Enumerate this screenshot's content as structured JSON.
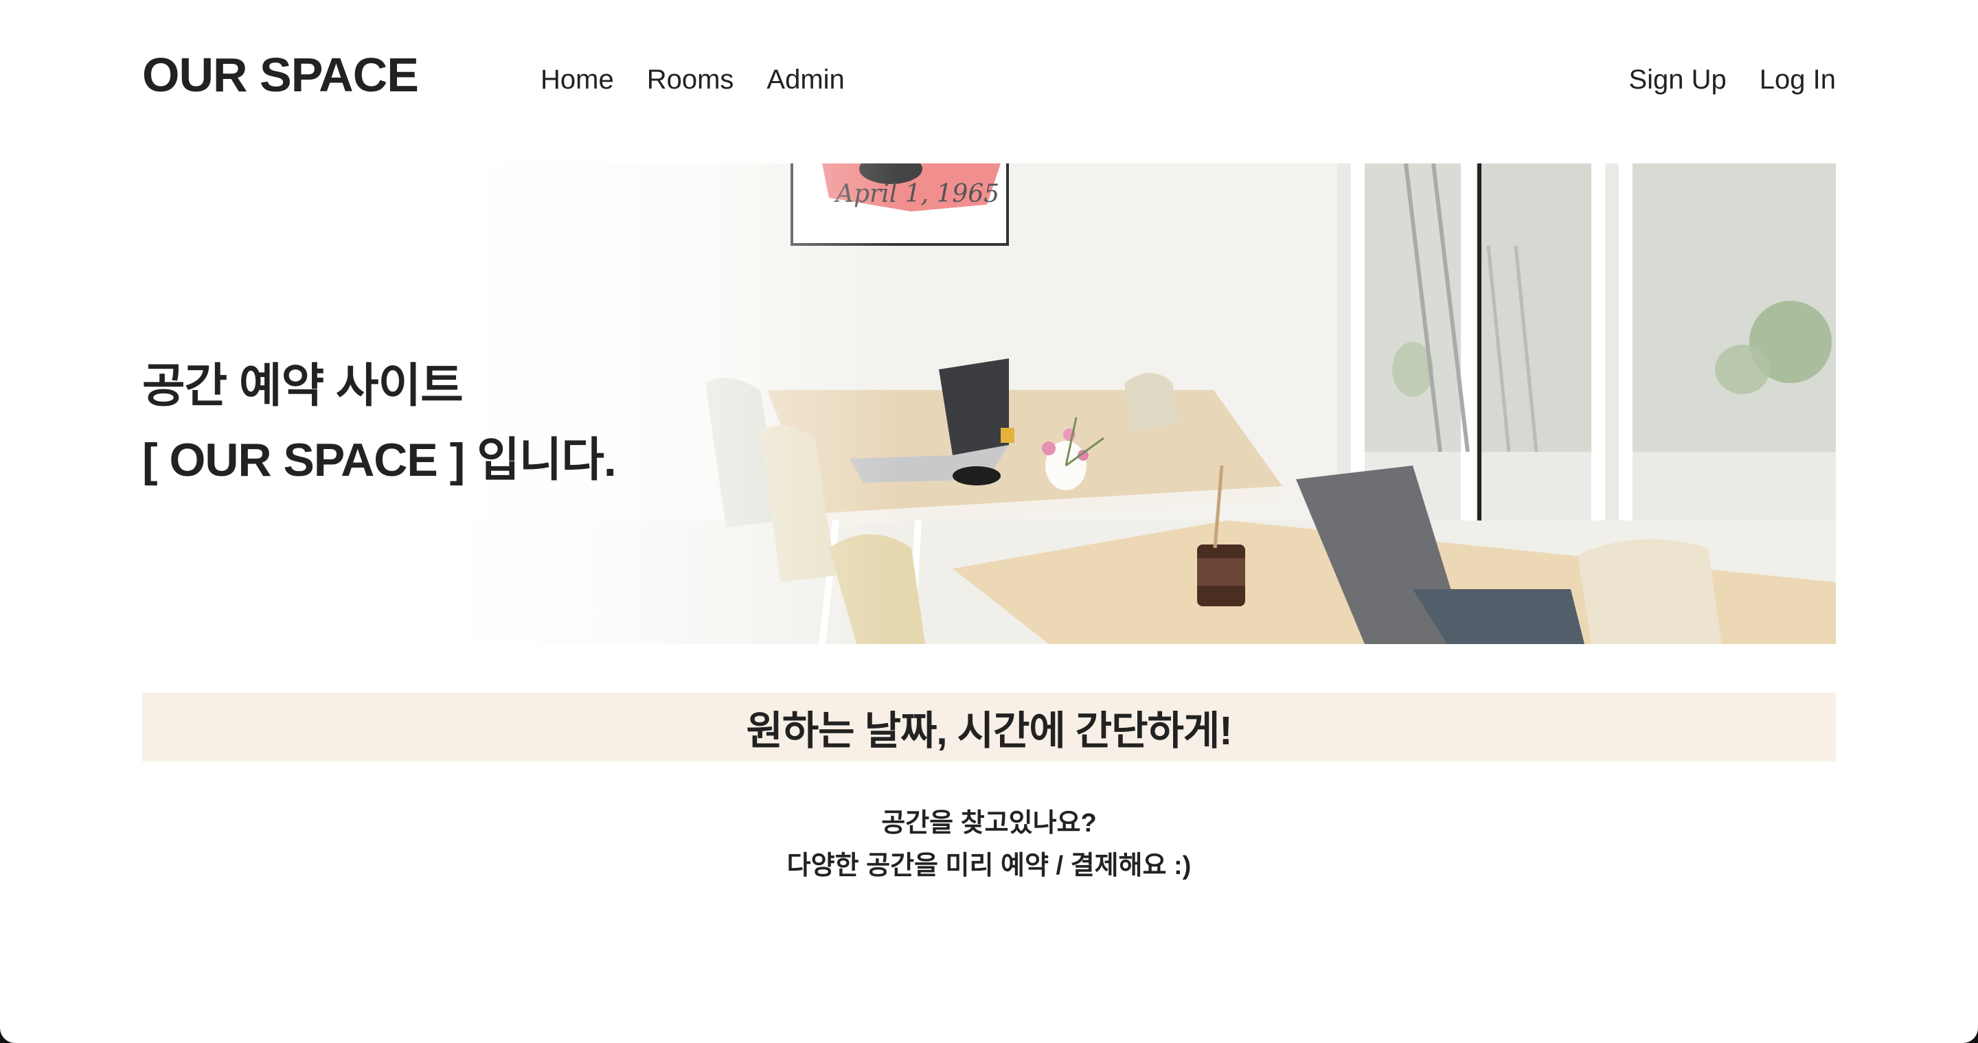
{
  "header": {
    "logo": "OUR SPACE",
    "nav": [
      {
        "label": "Home"
      },
      {
        "label": "Rooms"
      },
      {
        "label": "Admin"
      }
    ],
    "auth": {
      "signup_label": "Sign Up",
      "login_label": "Log In"
    }
  },
  "hero": {
    "line1": "공간 예약 사이트",
    "line2": "[ OUR SPACE ] 입니다.",
    "poster_text": "April 1, 1965"
  },
  "banner": {
    "text": "원하는 날짜, 시간에 간단하게!"
  },
  "intro": {
    "line1": "공간을 찾고있나요?",
    "line2": "다양한 공간을 미리 예약 / 결제해요 :)"
  },
  "colors": {
    "banner_bg": "#f8f0e6",
    "text": "#222222",
    "background": "#ffffff"
  }
}
